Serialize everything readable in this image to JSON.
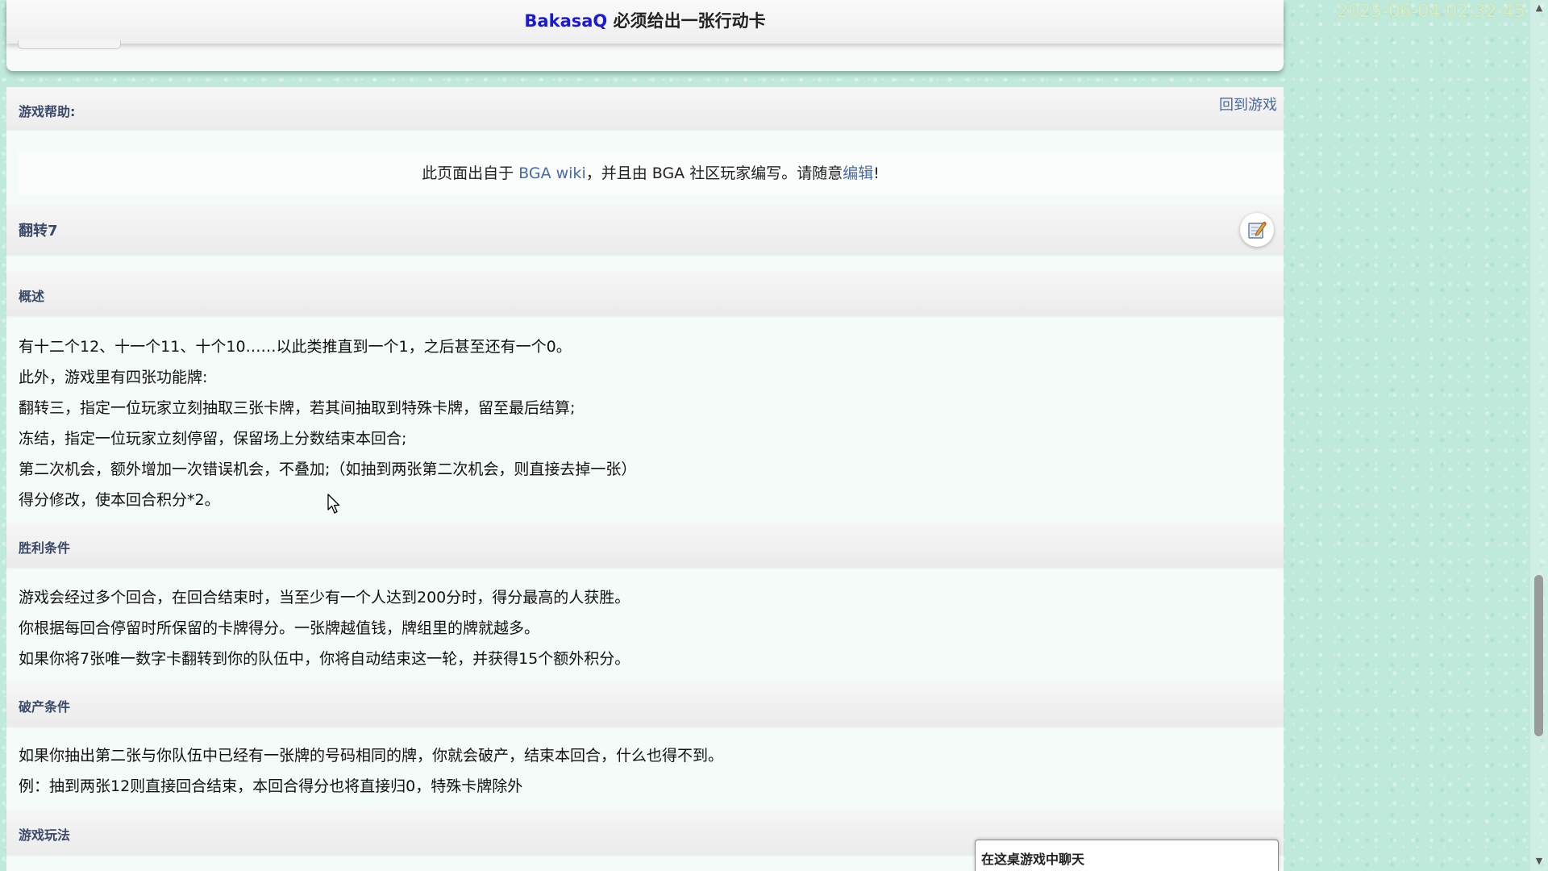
{
  "timestamp": "2025-06-04 02:32:45",
  "header": {
    "player_name": "BakasaQ",
    "status_text": "必须给出一张行动卡"
  },
  "help": {
    "label": "游戏帮助:",
    "back_link": "回到游戏"
  },
  "wiki_notice": {
    "prefix": "此页面出自于 ",
    "wiki_link": "BGA wiki",
    "middle": "，并且由 BGA 社区玩家编写。请随意",
    "edit_link": "编辑",
    "suffix": "!"
  },
  "game_title": "翻转7",
  "sections": {
    "overview": {
      "title": "概述",
      "lines": [
        "有十二个12、十一个11、十个10……以此类推直到一个1，之后甚至还有一个0。",
        "此外，游戏里有四张功能牌:",
        "翻转三，指定一位玩家立刻抽取三张卡牌，若其间抽取到特殊卡牌，留至最后结算;",
        "冻结，指定一位玩家立刻停留，保留场上分数结束本回合;",
        "第二次机会，额外增加一次错误机会，不叠加;（如抽到两张第二次机会，则直接去掉一张）",
        "得分修改，使本回合积分*2。"
      ]
    },
    "victory": {
      "title": "胜利条件",
      "lines": [
        "游戏会经过多个回合，在回合结束时，当至少有一个人达到200分时，得分最高的人获胜。",
        "你根据每回合停留时所保留的卡牌得分。一张牌越值钱，牌组里的牌就越多。",
        "如果你将7张唯一数字卡翻转到你的队伍中，你将自动结束这一轮，并获得15个额外积分。"
      ]
    },
    "bust": {
      "title": "破产条件",
      "lines": [
        "如果你抽出第二张与你队伍中已经有一张牌的号码相同的牌，你就会破产，结束本回合，什么也得不到。",
        "例：抽到两张12则直接回合结束，本回合得分也将直接归0，特殊卡牌除外"
      ]
    },
    "gameplay": {
      "title": "游戏玩法"
    }
  },
  "chat": {
    "label": "在这桌游戏中聊天"
  },
  "colors": {
    "player_name": "#1a1ad6",
    "link": "#4a6aa5",
    "section_title": "#3c4a6a",
    "background": "#bfe9db"
  }
}
